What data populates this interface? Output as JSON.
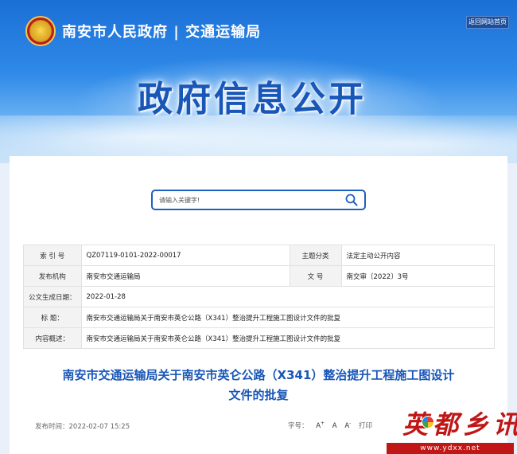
{
  "header": {
    "site_title": "南安市人民政府 | 交通运输局",
    "home_button": "返回网站首页",
    "banner_title": "政府信息公开"
  },
  "search": {
    "placeholder": "请输入关键字!"
  },
  "meta": {
    "index_label": "索 引 号",
    "index_value": "QZ07119-0101-2022-00017",
    "category_label": "主题分类",
    "category_value": "法定主动公开内容",
    "publisher_label": "发布机构",
    "publisher_value": "南安市交通运输局",
    "doc_no_label": "文 号",
    "doc_no_value": "南交审〔2022〕3号",
    "created_label": "公文生成日期：",
    "created_value": "2022-01-28",
    "title_label": "标 题：",
    "title_value": "南安市交通运输局关于南安市英仑公路（X341）整治提升工程施工图设计文件的批复",
    "summary_label": "内容概述：",
    "summary_value": "南安市交通运输局关于南安市英仑公路（X341）整治提升工程施工图设计文件的批复"
  },
  "document": {
    "title_line1": "南安市交通运输局关于南安市英仑公路（X341）整治提升工程施工图设计",
    "title_line2": "文件的批复",
    "publish_date": "发布时间：2022-02-07 15:25",
    "font_size_label": "字号：",
    "font_a": "A",
    "print_label": "打印"
  },
  "watermark": {
    "text": "英都乡讯",
    "url": "www.ydxx.net"
  },
  "colors": {
    "banner_blue": "#1b6fd6",
    "title_blue": "#1856b8",
    "watermark_red": "#c01616"
  }
}
